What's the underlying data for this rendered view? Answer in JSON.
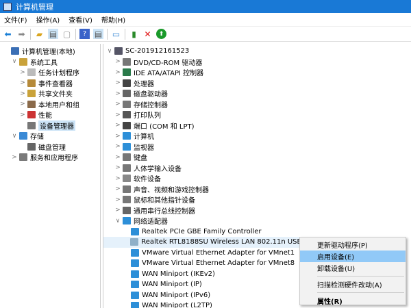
{
  "window": {
    "title": "计算机管理"
  },
  "menu": [
    "文件(F)",
    "操作(A)",
    "查看(V)",
    "帮助(H)"
  ],
  "toolbar": [
    "back-icon",
    "forward-icon",
    "up-folder-icon",
    "show-tree-icon",
    "properties-icon",
    "help-icon",
    "action-pane-icon",
    "monitor-icon",
    "update-driver-icon",
    "uninstall-icon",
    "enable-icon"
  ],
  "left_tree": [
    {
      "label": "计算机管理(本地)",
      "level": 0,
      "chevron": ""
    },
    {
      "label": "系统工具",
      "level": 1,
      "chevron": "∨"
    },
    {
      "label": "任务计划程序",
      "level": 2,
      "chevron": ">"
    },
    {
      "label": "事件查看器",
      "level": 2,
      "chevron": ">"
    },
    {
      "label": "共享文件夹",
      "level": 2,
      "chevron": ">"
    },
    {
      "label": "本地用户和组",
      "level": 2,
      "chevron": ">"
    },
    {
      "label": "性能",
      "level": 2,
      "chevron": ">"
    },
    {
      "label": "设备管理器",
      "level": 2,
      "chevron": ""
    },
    {
      "label": "存储",
      "level": 1,
      "chevron": "∨"
    },
    {
      "label": "磁盘管理",
      "level": 2,
      "chevron": ""
    },
    {
      "label": "服务和应用程序",
      "level": 1,
      "chevron": ">"
    }
  ],
  "device_tree": [
    {
      "label": "SC-201912161523",
      "level": 0,
      "chevron": "∨"
    },
    {
      "label": "DVD/CD-ROM 驱动器",
      "level": 1,
      "chevron": ">"
    },
    {
      "label": "IDE ATA/ATAPI 控制器",
      "level": 1,
      "chevron": ">"
    },
    {
      "label": "处理器",
      "level": 1,
      "chevron": ">"
    },
    {
      "label": "磁盘驱动器",
      "level": 1,
      "chevron": ">"
    },
    {
      "label": "存储控制器",
      "level": 1,
      "chevron": ">"
    },
    {
      "label": "打印队列",
      "level": 1,
      "chevron": ">"
    },
    {
      "label": "端口 (COM 和 LPT)",
      "level": 1,
      "chevron": ">"
    },
    {
      "label": "计算机",
      "level": 1,
      "chevron": ">"
    },
    {
      "label": "监视器",
      "level": 1,
      "chevron": ">"
    },
    {
      "label": "键盘",
      "level": 1,
      "chevron": ">"
    },
    {
      "label": "人体学输入设备",
      "level": 1,
      "chevron": ">"
    },
    {
      "label": "软件设备",
      "level": 1,
      "chevron": ">"
    },
    {
      "label": "声音、视频和游戏控制器",
      "level": 1,
      "chevron": ">"
    },
    {
      "label": "鼠标和其他指针设备",
      "level": 1,
      "chevron": ">"
    },
    {
      "label": "通用串行总线控制器",
      "level": 1,
      "chevron": ">"
    },
    {
      "label": "网络适配器",
      "level": 1,
      "chevron": "∨"
    },
    {
      "label": "Realtek PCIe GBE Family Controller",
      "level": 2,
      "chevron": ""
    },
    {
      "label": "Realtek RTL8188SU Wireless LAN 802.11n USB 2.0 Network Adapter",
      "level": 2,
      "chevron": "",
      "disabled": true
    },
    {
      "label": "VMware Virtual Ethernet Adapter for VMnet1",
      "level": 2,
      "chevron": ""
    },
    {
      "label": "VMware Virtual Ethernet Adapter for VMnet8",
      "level": 2,
      "chevron": ""
    },
    {
      "label": "WAN Miniport (IKEv2)",
      "level": 2,
      "chevron": ""
    },
    {
      "label": "WAN Miniport (IP)",
      "level": 2,
      "chevron": ""
    },
    {
      "label": "WAN Miniport (IPv6)",
      "level": 2,
      "chevron": ""
    },
    {
      "label": "WAN Miniport (L2TP)",
      "level": 2,
      "chevron": ""
    }
  ],
  "context_menu": {
    "items": [
      "更新驱动程序(P)",
      "启用设备(E)",
      "卸载设备(U)",
      "扫描检测硬件改动(A)",
      "属性(R)"
    ],
    "active": 1
  },
  "colors": {
    "title_bar": "#1979d6",
    "selection": "#cce4f7",
    "menu_active": "#91c9f7"
  }
}
